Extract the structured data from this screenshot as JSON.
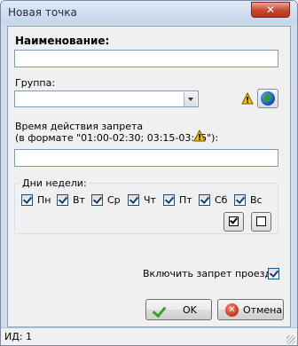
{
  "window": {
    "title": "Новая точка",
    "close_label": "✕"
  },
  "name_field": {
    "label": "Наименование:",
    "value": ""
  },
  "group_field": {
    "label": "Группа:",
    "value": ""
  },
  "time_field": {
    "label_line1": "Время действия запрета",
    "label_line2": "(в формате \"01:00-02:30; 03:15-03:45\"):",
    "value": ""
  },
  "weekdays": {
    "title": "Дни недели:",
    "days": [
      {
        "label": "Пн",
        "checked": true
      },
      {
        "label": "Вт",
        "checked": true
      },
      {
        "label": "Ср",
        "checked": true
      },
      {
        "label": "Чт",
        "checked": true
      },
      {
        "label": "Пт",
        "checked": true
      },
      {
        "label": "Сб",
        "checked": true
      },
      {
        "label": "Вс",
        "checked": true
      }
    ]
  },
  "enable_ban": {
    "label": "Включить запрет проезда",
    "checked": true
  },
  "buttons": {
    "ok": "OK",
    "cancel": "Отмена"
  },
  "status": {
    "id_text": "ИД: 1"
  },
  "colors": {
    "warning": "#f2c200",
    "ok_green": "#3da12a",
    "cancel_red": "#c8321c"
  },
  "icons": [
    "warning-icon",
    "globe-icon",
    "checkmark-icon",
    "cancel-icon"
  ]
}
